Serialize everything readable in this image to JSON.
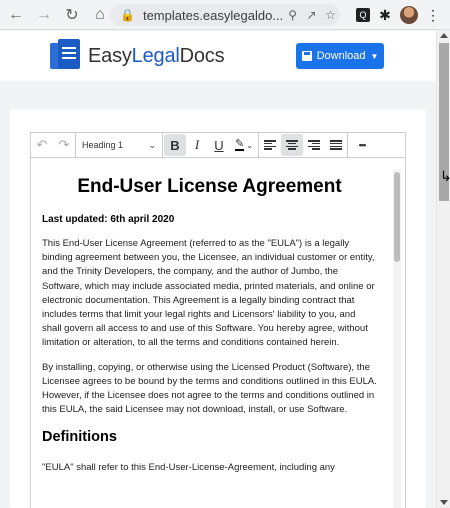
{
  "browser": {
    "url": "templates.easylegaldo...",
    "back_icon": "arrow-left-icon",
    "forward_icon": "arrow-right-icon",
    "refresh_icon": "refresh-icon",
    "home_icon": "home-icon"
  },
  "site": {
    "logo_prefix": "Easy",
    "logo_highlight": "Legal",
    "logo_suffix": "Docs",
    "download_label": "Download",
    "accent_color": "#1a73e8"
  },
  "toolbar": {
    "heading_select": "Heading 1",
    "bold": "B",
    "italic": "I",
    "underline": "U",
    "more": "•••"
  },
  "document": {
    "title": "End-User License Agreement",
    "updated": "Last updated: 6th april 2020",
    "para1": "This End-User License Agreement (referred to as the \"EULA\") is a legally binding agreement between you, the Licensee, an individual customer or entity, and the Trinity Developers, the company, and the author of Jumbo, the Software, which may include associated media, printed materials, and online or electronic documentation. This Agreement is a legally binding contract that includes terms that limit your legal rights and Licensors' liability to you, and shall govern all access to and use of this Software. You hereby agree, without limitation or alteration, to all the terms and conditions contained herein.",
    "para2": "By installing, copying, or otherwise using the Licensed Product (Software), the Licensee agrees to be bound by the terms and conditions outlined in this EULA. However, if the Licensee does not agree to the terms and conditions outlined in this EULA, the said Licensee may not download, install, or use Software.",
    "section_heading": "Definitions",
    "para3": " \"EULA\" shall refer to this End-User-License-Agreement, including any"
  }
}
